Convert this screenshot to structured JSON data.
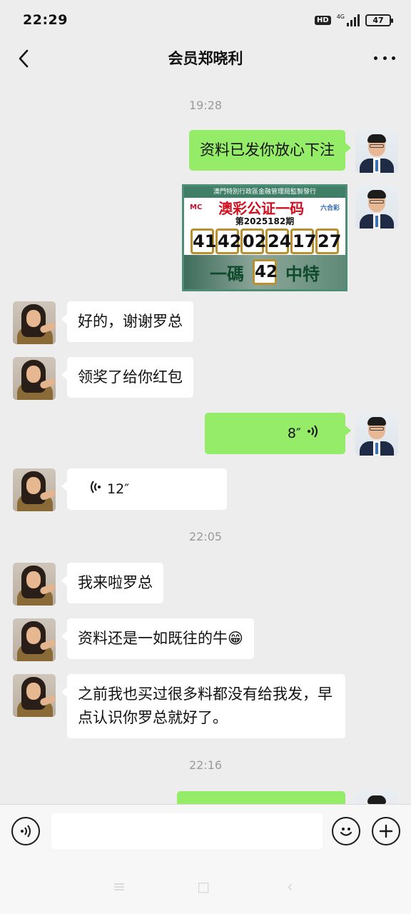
{
  "status_bar": {
    "time": "22:29",
    "hd": "HD",
    "network": "4G",
    "battery": "47"
  },
  "header": {
    "back_icon": "back-arrow-icon",
    "title": "会员郑晓利",
    "more_icon": "more-dots-icon"
  },
  "chat": {
    "timestamps": [
      "19:28",
      "22:05",
      "22:16"
    ],
    "messages": [
      {
        "from": "me",
        "type": "text",
        "text": "资料已发你放心下注"
      },
      {
        "from": "me",
        "type": "image"
      },
      {
        "from": "them",
        "type": "text",
        "text": "好的，谢谢罗总"
      },
      {
        "from": "them",
        "type": "text",
        "text": "领奖了给你红包"
      },
      {
        "from": "me",
        "type": "voice",
        "duration": "8″"
      },
      {
        "from": "them",
        "type": "voice",
        "duration": "12″"
      },
      {
        "from": "them",
        "type": "text",
        "text": "我来啦罗总"
      },
      {
        "from": "them",
        "type": "text",
        "text": "资料还是一如既往的牛😁"
      },
      {
        "from": "them",
        "type": "text",
        "text": "之前我也买过很多料都没有给我发，早点认识你罗总就好了。"
      }
    ]
  },
  "poster": {
    "top_strip": "澳門特別行政區金融管理局監製發行",
    "logo_left": "MC",
    "title": "澳彩公证一码",
    "logo_right": "六合彩",
    "issue": "第2025182期",
    "numbers": [
      "41",
      "42",
      "02",
      "24",
      "17",
      "27"
    ],
    "bottom_left": "一碼",
    "special": "42",
    "bottom_right": "中特"
  },
  "input_bar": {
    "voice_icon": "voice-mode-icon",
    "emoji_icon": "emoji-icon",
    "plus_icon": "plus-icon",
    "placeholder": ""
  },
  "system_nav": {
    "menu": "≡",
    "home": "◻",
    "back": "‹"
  },
  "colors": {
    "background": "#ededed",
    "my_bubble": "#95ec69",
    "their_bubble": "#ffffff",
    "timestamp": "#9a9a9a"
  }
}
